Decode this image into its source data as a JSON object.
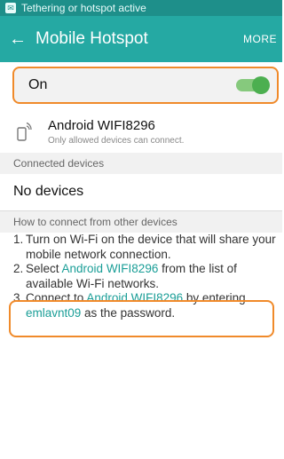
{
  "status_bar": {
    "text": "Tethering or hotspot active",
    "icon": "notification-icon"
  },
  "app_bar": {
    "title": "Mobile Hotspot",
    "more_label": "MORE",
    "back_icon": "back-arrow-icon"
  },
  "toggle": {
    "label": "On",
    "state": "on"
  },
  "network": {
    "name": "Android WIFI8296",
    "subtitle": "Only allowed devices can connect."
  },
  "connected_devices": {
    "header": "Connected devices",
    "empty_text": "No devices"
  },
  "how_to": {
    "header": "How to connect from other devices",
    "steps": [
      {
        "number": "1.",
        "text": "Turn on Wi-Fi on the device that will share your mobile network connection."
      },
      {
        "number": "2.",
        "before": "Select ",
        "link": "Android WIFI8296",
        "after": " from the list of available Wi-Fi networks."
      },
      {
        "number": "3.",
        "before": "Connect to ",
        "link": "Android WIFI8296",
        "middle": " by entering",
        "password": "emlavnt09",
        "after": " as the password."
      }
    ]
  },
  "colors": {
    "status_bar": "#1e8f8a",
    "app_bar": "#25a9a3",
    "accent_link": "#1a9e97",
    "highlight_outline": "#f08a2a",
    "switch_on": "#4caf50"
  }
}
